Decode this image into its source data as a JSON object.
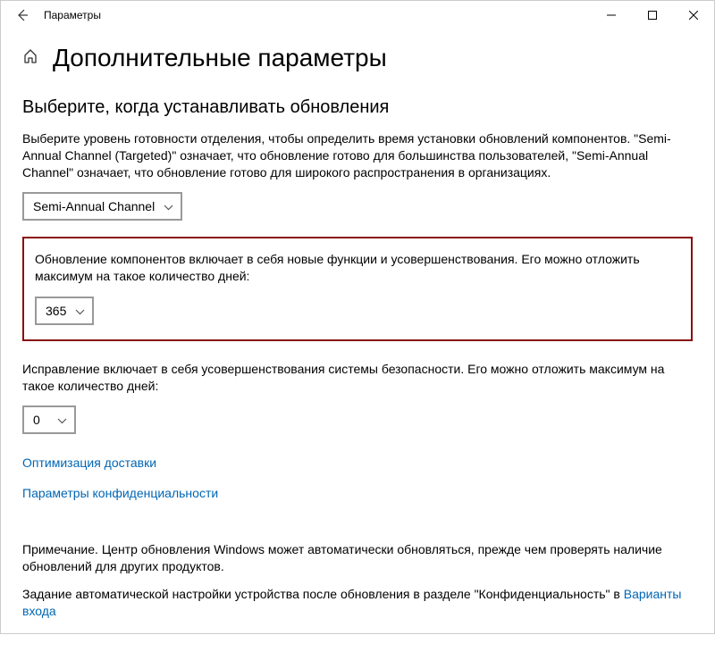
{
  "titlebar": {
    "title": "Параметры"
  },
  "header": {
    "page_title": "Дополнительные параметры"
  },
  "section": {
    "heading": "Выберите, когда устанавливать обновления",
    "intro": "Выберите уровень готовности отделения, чтобы определить время установки обновлений компонентов. \"Semi-Annual Channel (Targeted)\" означает, что обновление готово для большинства пользователей, \"Semi-Annual Channel\" означает, что обновление готово для широкого распространения в организациях.",
    "channel_dropdown": "Semi-Annual Channel",
    "feature_defer_text": "Обновление компонентов включает в себя новые функции и усовершенствования. Его можно отложить максимум на такое количество дней:",
    "feature_defer_value": "365",
    "quality_defer_text": "Исправление включает в себя усовершенствования системы безопасности. Его можно отложить максимум на такое количество дней:",
    "quality_defer_value": "0"
  },
  "links": {
    "delivery": "Оптимизация доставки",
    "privacy": "Параметры конфиденциальности"
  },
  "notes": {
    "line1": "Примечание. Центр обновления Windows может автоматически обновляться, прежде чем проверять наличие обновлений для других продуктов.",
    "line2_prefix": "Задание автоматической настройки устройства после обновления в разделе \"Конфиденциальность\" в ",
    "line2_link": "Варианты входа"
  }
}
